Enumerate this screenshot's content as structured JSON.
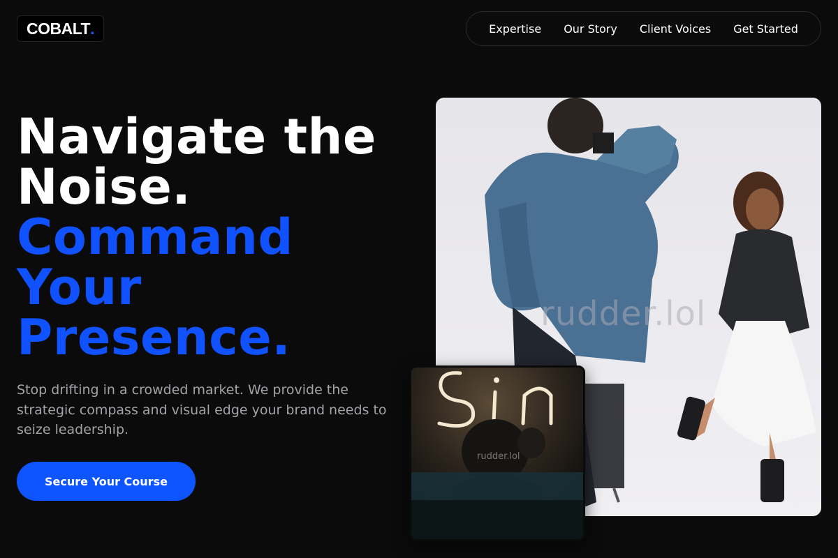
{
  "brand": {
    "name": "COBALT",
    "dot": "."
  },
  "nav": {
    "items": [
      "Expertise",
      "Our Story",
      "Client Voices",
      "Get Started"
    ]
  },
  "hero": {
    "headline_white": [
      "Navigate the",
      "Noise."
    ],
    "headline_blue": [
      "Command",
      "Your",
      "Presence."
    ],
    "subtext": "Stop drifting in a crowded market. We provide the strategic compass and visual edge your brand needs to seize leadership.",
    "cta_label": "Secure Your Course"
  },
  "media": {
    "main_image_watermark": "rudder.lol",
    "inset_image_watermark": "rudder.lol",
    "inset_neon_text": "Sin"
  },
  "colors": {
    "background": "#0b0b0c",
    "accent": "#0f55ff",
    "text": "#ffffff",
    "muted": "#a3a3a8"
  }
}
